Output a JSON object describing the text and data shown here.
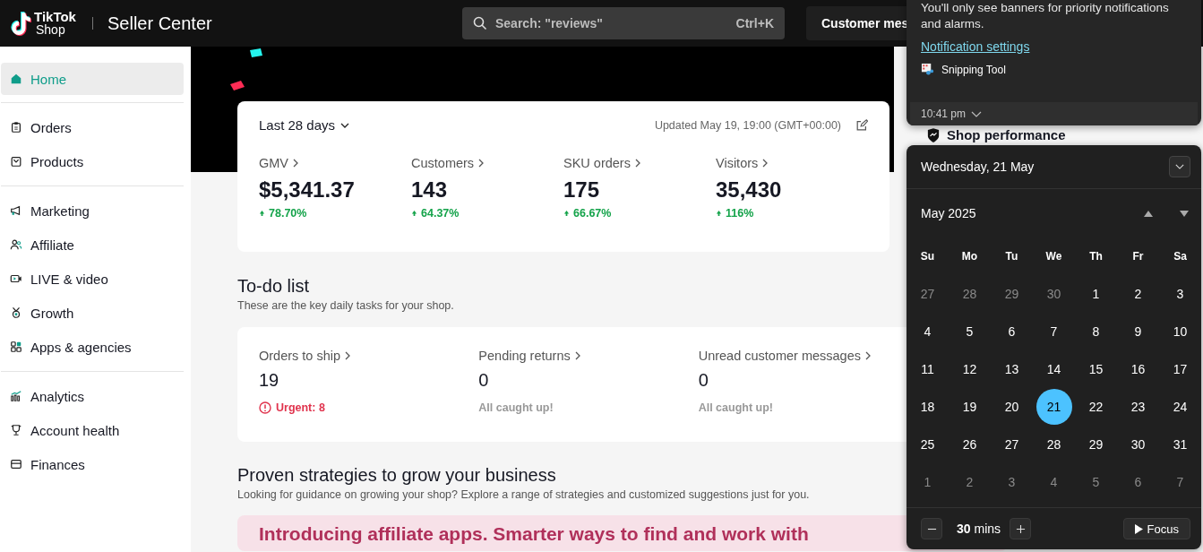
{
  "topbar": {
    "logo": {
      "line1": "TikTok",
      "line2": "Shop"
    },
    "title": "Seller Center",
    "search": {
      "placeholder": "Search: \"reviews\"",
      "shortcut": "Ctrl+K"
    },
    "button": "Customer mes"
  },
  "sidebar": {
    "groups": [
      [
        {
          "label": "Home",
          "selected": true
        }
      ],
      [
        {
          "label": "Orders",
          "selected": false
        },
        {
          "label": "Products",
          "selected": false
        }
      ],
      [
        {
          "label": "Marketing",
          "selected": false
        },
        {
          "label": "Affiliate",
          "selected": false
        },
        {
          "label": "LIVE & video",
          "selected": false
        },
        {
          "label": "Growth",
          "selected": false
        },
        {
          "label": "Apps & agencies",
          "selected": false
        }
      ],
      [
        {
          "label": "Analytics",
          "selected": false
        },
        {
          "label": "Account health",
          "selected": false
        },
        {
          "label": "Finances",
          "selected": false
        }
      ]
    ]
  },
  "overview": {
    "period": "Last 28 days",
    "updated": "Updated May 19, 19:00 (GMT+00:00)",
    "metrics": [
      {
        "label": "GMV",
        "value": "$5,341.37",
        "change": "78.70%"
      },
      {
        "label": "Customers",
        "value": "143",
        "change": "64.37%"
      },
      {
        "label": "SKU orders",
        "value": "175",
        "change": "66.67%"
      },
      {
        "label": "Visitors",
        "value": "35,430",
        "change": "116%"
      }
    ]
  },
  "todo": {
    "title": "To-do list",
    "subtitle": "These are the key daily tasks for your shop.",
    "items": [
      {
        "label": "Orders to ship",
        "value": "19",
        "note": "Urgent: 8",
        "kind": "urgent"
      },
      {
        "label": "Pending returns",
        "value": "0",
        "note": "All caught up!",
        "kind": "ok"
      },
      {
        "label": "Unread customer messages",
        "value": "0",
        "note": "All caught up!",
        "kind": "ok"
      }
    ]
  },
  "strategies": {
    "title": "Proven strategies to grow your business",
    "subtitle": "Looking for guidance on growing your shop? Explore a range of strategies and customized suggestions just for you.",
    "banner": "Introducing affiliate apps. Smarter ways to find and work with"
  },
  "shop_performance": {
    "title": "Shop performance"
  },
  "notification": {
    "text": "You'll only see banners for priority notifications and alarms.",
    "link": "Notification settings",
    "app": "Snipping Tool",
    "time": "10:41 pm"
  },
  "calendar": {
    "date": "Wednesday, 21 May",
    "month": "May 2025",
    "weekdays": [
      "Su",
      "Mo",
      "Tu",
      "We",
      "Th",
      "Fr",
      "Sa"
    ],
    "days": [
      {
        "day": "27",
        "in_month": false,
        "selected": false
      },
      {
        "day": "28",
        "in_month": false,
        "selected": false
      },
      {
        "day": "29",
        "in_month": false,
        "selected": false
      },
      {
        "day": "30",
        "in_month": false,
        "selected": false
      },
      {
        "day": "1",
        "in_month": true,
        "selected": false
      },
      {
        "day": "2",
        "in_month": true,
        "selected": false
      },
      {
        "day": "3",
        "in_month": true,
        "selected": false
      },
      {
        "day": "4",
        "in_month": true,
        "selected": false
      },
      {
        "day": "5",
        "in_month": true,
        "selected": false
      },
      {
        "day": "6",
        "in_month": true,
        "selected": false
      },
      {
        "day": "7",
        "in_month": true,
        "selected": false
      },
      {
        "day": "8",
        "in_month": true,
        "selected": false
      },
      {
        "day": "9",
        "in_month": true,
        "selected": false
      },
      {
        "day": "10",
        "in_month": true,
        "selected": false
      },
      {
        "day": "11",
        "in_month": true,
        "selected": false
      },
      {
        "day": "12",
        "in_month": true,
        "selected": false
      },
      {
        "day": "13",
        "in_month": true,
        "selected": false
      },
      {
        "day": "14",
        "in_month": true,
        "selected": false
      },
      {
        "day": "15",
        "in_month": true,
        "selected": false
      },
      {
        "day": "16",
        "in_month": true,
        "selected": false
      },
      {
        "day": "17",
        "in_month": true,
        "selected": false
      },
      {
        "day": "18",
        "in_month": true,
        "selected": false
      },
      {
        "day": "19",
        "in_month": true,
        "selected": false
      },
      {
        "day": "20",
        "in_month": true,
        "selected": false
      },
      {
        "day": "21",
        "in_month": true,
        "selected": true
      },
      {
        "day": "22",
        "in_month": true,
        "selected": false
      },
      {
        "day": "23",
        "in_month": true,
        "selected": false
      },
      {
        "day": "24",
        "in_month": true,
        "selected": false
      },
      {
        "day": "25",
        "in_month": true,
        "selected": false
      },
      {
        "day": "26",
        "in_month": true,
        "selected": false
      },
      {
        "day": "27",
        "in_month": true,
        "selected": false
      },
      {
        "day": "28",
        "in_month": true,
        "selected": false
      },
      {
        "day": "29",
        "in_month": true,
        "selected": false
      },
      {
        "day": "30",
        "in_month": true,
        "selected": false
      },
      {
        "day": "31",
        "in_month": true,
        "selected": false
      },
      {
        "day": "1",
        "in_month": false,
        "selected": false
      },
      {
        "day": "2",
        "in_month": false,
        "selected": false
      },
      {
        "day": "3",
        "in_month": false,
        "selected": false
      },
      {
        "day": "4",
        "in_month": false,
        "selected": false
      },
      {
        "day": "5",
        "in_month": false,
        "selected": false
      },
      {
        "day": "6",
        "in_month": false,
        "selected": false
      },
      {
        "day": "7",
        "in_month": false,
        "selected": false
      }
    ],
    "focus": {
      "minutes": "30",
      "unit": "mins",
      "button": "Focus"
    }
  }
}
